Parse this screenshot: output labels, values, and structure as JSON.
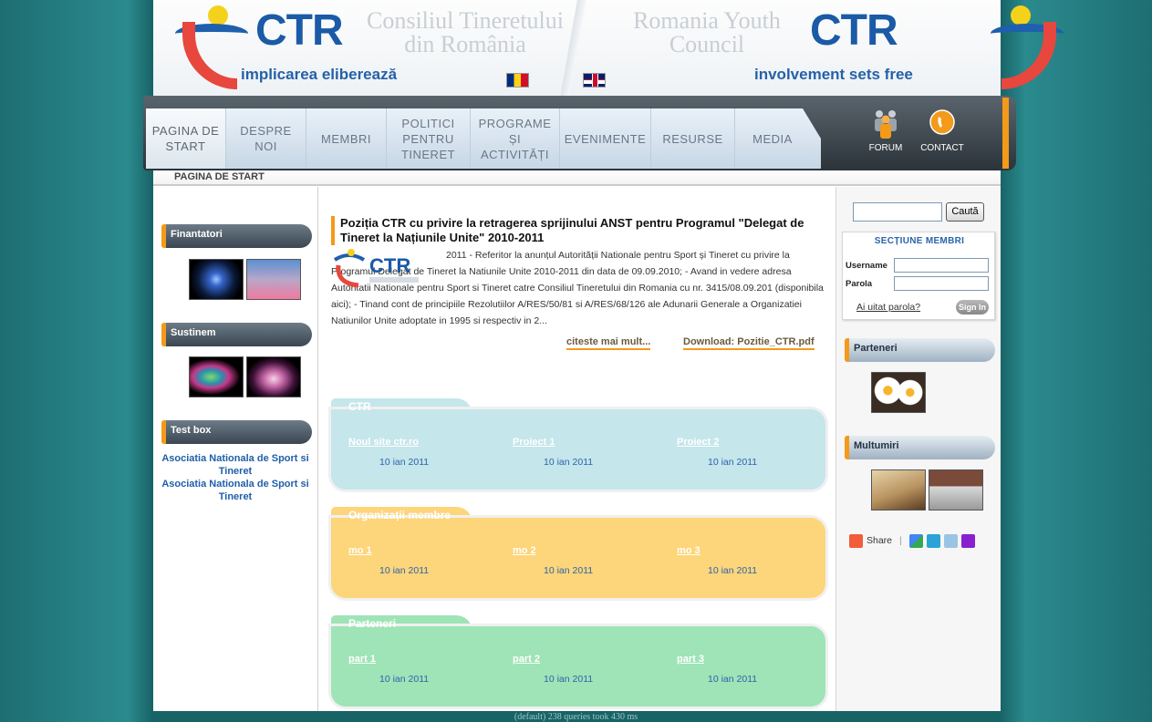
{
  "header": {
    "logo_left": "CTR",
    "logo_right": "CTR",
    "title_ro": "Consiliul Tineretului din România",
    "title_en": "Romania Youth Council",
    "tagline_ro": "implicarea eliberează",
    "tagline_en": "involvement sets free"
  },
  "nav": {
    "items": [
      {
        "label": "PAGINA DE\nSTART"
      },
      {
        "label": "DESPRE\nNOI"
      },
      {
        "label": "MEMBRI"
      },
      {
        "label": "POLITICI\nPENTRU\nTINERET"
      },
      {
        "label": "PROGRAME\nȘI\nACTIVITĂȚI"
      },
      {
        "label": "EVENIMENTE"
      },
      {
        "label": "RESURSE"
      },
      {
        "label": "MEDIA"
      }
    ],
    "forum": "FORUM",
    "contact": "CONTACT"
  },
  "breadcrumb": "PAGINA DE START",
  "left": {
    "finantatori": "Finantatori",
    "sustinem": "Sustinem",
    "testbox": "Test box",
    "testbox_links": [
      "Asociatia Nationala de Sport si Tineret",
      "Asociatia Nationala de Sport si Tineret"
    ]
  },
  "article": {
    "title": "Poziția CTR cu privire la retragerea sprijinului ANST pentru Programul \"Delegat de Tineret la Națiunile Unite\" 2010-2011",
    "body": "2011 - Referitor la anunțul Autorității Nationale pentru Sport și Tineret cu privire la Programul Delegat de Tineret la Natiunile Unite 2010-2011 din data de 09.09.2010; - Avand in vedere adresa Autoritatii Nationale pentru Sport si Tineret catre Consiliul Tineretului din Romania cu nr. 3415/08.09.201 (disponibila aici); - Tinand cont de principiile Rezolutiilor A/RES/50/81 si A/RES/68/126 ale Adunarii Generale a Organizatiei Natiunilor Unite adoptate in 1995 si respectiv in 2...",
    "read_more": "citeste mai mult...",
    "download": "Download: Pozitie_CTR.pdf"
  },
  "boxes": [
    {
      "title": "CTR",
      "color": "#c5e6ea",
      "items": [
        {
          "link": "Noul site ctr.ro",
          "date": "10 ian 2011"
        },
        {
          "link": "Proiect 1",
          "date": "10 ian 2011"
        },
        {
          "link": "Proiect 2",
          "date": "10 ian 2011"
        }
      ]
    },
    {
      "title": "Organizații membre",
      "color": "#fdd57a",
      "items": [
        {
          "link": "mo 1",
          "date": "10 ian 2011"
        },
        {
          "link": "mo 2",
          "date": "10 ian 2011"
        },
        {
          "link": "mo 3",
          "date": "10 ian 2011"
        }
      ]
    },
    {
      "title": "Parteneri",
      "color": "#9ee4b6",
      "items": [
        {
          "link": "part 1",
          "date": "10 ian 2011"
        },
        {
          "link": "part 2",
          "date": "10 ian 2011"
        },
        {
          "link": "part 3",
          "date": "10 ian 2011"
        }
      ]
    }
  ],
  "right": {
    "search_button": "Caută",
    "members_header": "SECȚIUNE MEMBRI",
    "username": "Username",
    "password": "Parola",
    "forgot": "Ai uitat parola?",
    "signin": "Sign In",
    "parteneri": "Parteneri",
    "multumiri": "Multumiri",
    "share": "Share"
  },
  "footer": "(default) 238 queries took 430 ms"
}
